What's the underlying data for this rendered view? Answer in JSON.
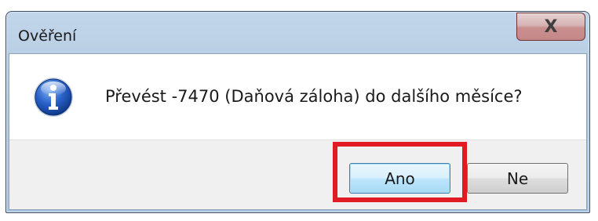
{
  "window": {
    "title": "Ověření",
    "close_label": "X"
  },
  "dialog": {
    "icon": "info-icon",
    "message": "Převést -7470 (Daňová záloha) do dalšího měsíce?"
  },
  "buttons": {
    "yes_label": "Ano",
    "no_label": "Ne"
  },
  "highlight": {
    "target": "yes-button",
    "color": "#e01b24"
  }
}
